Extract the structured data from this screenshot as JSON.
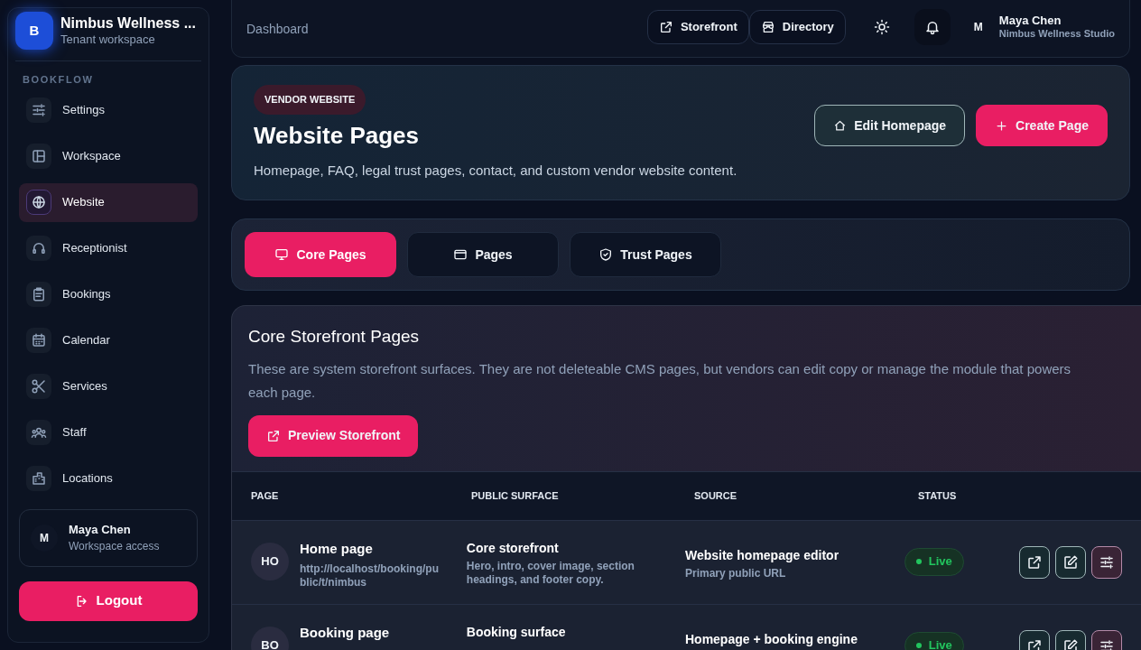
{
  "sidebar": {
    "brand": {
      "initial": "B",
      "name": "Nimbus Wellness ...",
      "subtitle": "Tenant workspace"
    },
    "section": "BOOKFLOW",
    "items": [
      {
        "label": "Settings",
        "selected": false
      },
      {
        "label": "Workspace",
        "selected": false
      },
      {
        "label": "Website",
        "selected": true
      },
      {
        "label": "Receptionist",
        "selected": false
      },
      {
        "label": "Bookings",
        "selected": false
      },
      {
        "label": "Calendar",
        "selected": false
      },
      {
        "label": "Services",
        "selected": false
      },
      {
        "label": "Staff",
        "selected": false
      },
      {
        "label": "Locations",
        "selected": false
      }
    ],
    "user": {
      "initial": "M",
      "name": "Maya Chen",
      "subtitle": "Workspace access"
    },
    "logout": "Logout"
  },
  "topbar": {
    "breadcrumb": "Dashboard",
    "links": [
      {
        "label": "Storefront"
      },
      {
        "label": "Directory"
      }
    ],
    "user": {
      "initial": "M",
      "name": "Maya Chen",
      "subtitle": "Nimbus Wellness Studio"
    }
  },
  "header": {
    "badge": "VENDOR WEBSITE",
    "title": "Website Pages",
    "description": "Homepage, FAQ, legal trust pages, contact, and custom vendor website content.",
    "actions": [
      {
        "label": "Edit Homepage",
        "kind": "secondary"
      },
      {
        "label": "Create Page",
        "kind": "primary"
      }
    ]
  },
  "tabs": [
    {
      "label": "Core Pages",
      "selected": true
    },
    {
      "label": "Pages",
      "selected": false
    },
    {
      "label": "Trust Pages",
      "selected": false
    }
  ],
  "section": {
    "title": "Core Storefront Pages",
    "description": "These are system storefront surfaces. They are not deleteable CMS pages, but vendors can edit copy or manage the module that powers each page.",
    "button": "Preview Storefront"
  },
  "table": {
    "columns": [
      "PAGE",
      "PUBLIC SURFACE",
      "SOURCE",
      "STATUS"
    ],
    "rows": [
      {
        "initials": "HO",
        "page": "Home page",
        "url": "http://localhost/booking/public/t/nimbus",
        "surface": "Core storefront",
        "surface_note": "Hero, intro, cover image, section headings, and footer copy.",
        "source": "Website homepage editor",
        "source_note": "Primary public URL",
        "status": "Live",
        "color": "#22c55e"
      },
      {
        "initials": "BO",
        "page": "Booking page",
        "surface": "Booking surface",
        "source": "Homepage + booking engine",
        "status": "Live",
        "color": "#22c55e"
      }
    ]
  }
}
